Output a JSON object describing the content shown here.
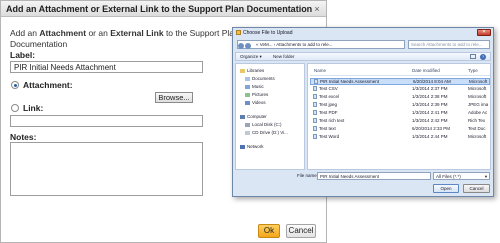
{
  "dialog": {
    "title": "Add an Attachment or External Link to the Support Plan Documentation",
    "close_glyph": "×",
    "desc_prefix": "Add an ",
    "desc_attachment": "Attachment",
    "desc_middle": " or an ",
    "desc_link": "External Link",
    "desc_suffix": " to the Support Plan Documentation",
    "label_label": "Label:",
    "label_value": "PIR Initial Needs Attachment",
    "attachment_label": "Attachment:",
    "attachment_selected": true,
    "browse_label": "Browse...",
    "link_label": "Link:",
    "link_selected": false,
    "link_value": "",
    "notes_label": "Notes:",
    "notes_value": "",
    "ok_label": "Ok",
    "cancel_label": "Cancel",
    "colors": {
      "ok_button": "#f3a51a",
      "radio_selected": "#2a5fa8"
    }
  },
  "file_dialog": {
    "title": "Choose File to Upload",
    "address": "« VeM... › Attachments to add to rele...",
    "search_placeholder": "Search Attachments to add to rele...",
    "toolbar": {
      "organize": "Organize ▾",
      "new_folder": "New folder"
    },
    "tree": [
      {
        "label": "Libraries",
        "icon": "library-icon"
      },
      {
        "label": "Documents",
        "icon": "documents-icon"
      },
      {
        "label": "Music",
        "icon": "music-icon"
      },
      {
        "label": "Pictures",
        "icon": "pictures-icon"
      },
      {
        "label": "Videos",
        "icon": "videos-icon"
      },
      {
        "label": "Computer",
        "icon": "computer-icon"
      },
      {
        "label": "Local Disk (C:)",
        "icon": "disk-icon"
      },
      {
        "label": "CD Drive (D:) Vi...",
        "icon": "cd-drive-icon"
      },
      {
        "label": "Network",
        "icon": "network-icon"
      }
    ],
    "columns": {
      "name": "Name",
      "date": "Date modified",
      "type": "Type"
    },
    "files": [
      {
        "name": "PIR Initial Needs Assessment",
        "date": "6/20/2014 8:04 AM",
        "type": "Microsoft"
      },
      {
        "name": "Test CSV",
        "date": "1/3/2014 2:37 PM",
        "type": "Microsoft"
      },
      {
        "name": "Test excel",
        "date": "1/3/2014 2:38 PM",
        "type": "Microsoft"
      },
      {
        "name": "Test jpeg",
        "date": "1/3/2014 2:39 PM",
        "type": "JPEG ima"
      },
      {
        "name": "Test PDF",
        "date": "1/3/2014 2:41 PM",
        "type": "Adobe Ac"
      },
      {
        "name": "Test rich text",
        "date": "1/3/2014 2:42 PM",
        "type": "Rich Tex"
      },
      {
        "name": "Test text",
        "date": "6/20/2014 2:33 PM",
        "type": "Text Doc"
      },
      {
        "name": "Test Word",
        "date": "1/3/2014 2:44 PM",
        "type": "Microsoft"
      }
    ],
    "selected_index": 0,
    "filename_label": "File name:",
    "filename_value": "PIR Initial Needs Assessment",
    "filetype_value": "All Files (*.*)",
    "open_label": "Open",
    "cancel_label": "Cancel"
  }
}
